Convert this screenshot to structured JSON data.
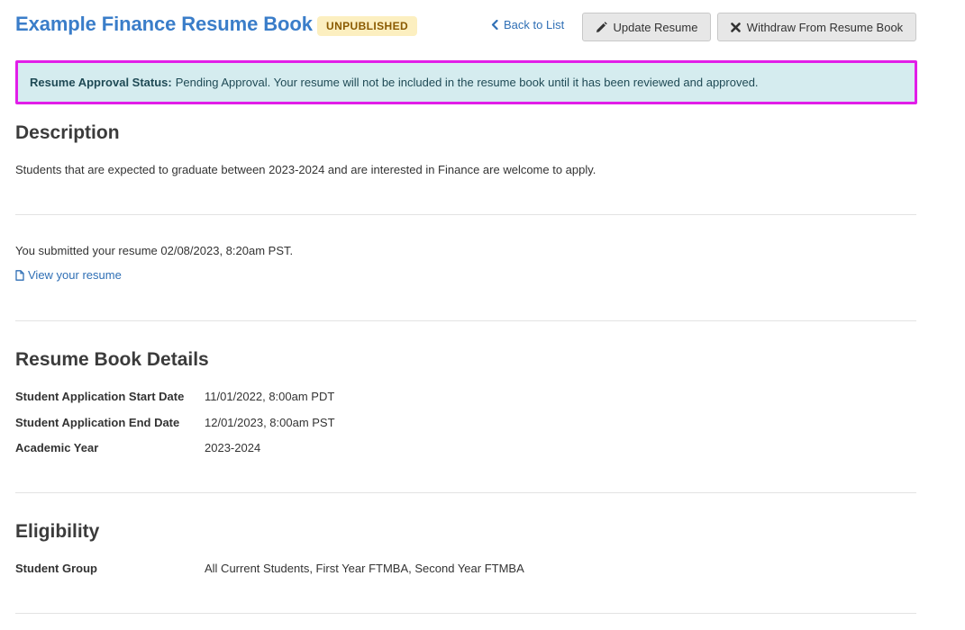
{
  "header": {
    "title": "Example Finance Resume Book",
    "status_badge": "UNPUBLISHED",
    "back_link": "Back to List",
    "update_button": "Update Resume",
    "withdraw_button": "Withdraw From Resume Book"
  },
  "approval": {
    "label": "Resume Approval Status:",
    "message": "Pending Approval. Your resume will not be included in the resume book until it has been reviewed and approved."
  },
  "description": {
    "heading": "Description",
    "text": "Students that are expected to graduate between 2023-2024 and are interested in Finance are welcome to apply."
  },
  "submission": {
    "text": "You submitted your resume 02/08/2023, 8:20am PST.",
    "view_link": "View your resume"
  },
  "details": {
    "heading": "Resume Book Details",
    "rows": [
      {
        "label": "Student Application Start Date",
        "value": "11/01/2022, 8:00am PDT"
      },
      {
        "label": "Student Application End Date",
        "value": "12/01/2023, 8:00am PST"
      },
      {
        "label": "Academic Year",
        "value": "2023-2024"
      }
    ]
  },
  "eligibility": {
    "heading": "Eligibility",
    "rows": [
      {
        "label": "Student Group",
        "value": "All Current Students, First Year FTMBA, Second Year FTMBA"
      }
    ]
  },
  "colors": {
    "title": "#3a7dc9",
    "badge_bg": "#fcefc0",
    "badge_text": "#8a5a00",
    "banner_bg": "#d5ecef",
    "banner_border": "#e11ee8",
    "link": "#2f6fb5"
  },
  "icons": {
    "back": "chevron-left-icon",
    "update": "pencil-icon",
    "withdraw": "x-icon",
    "resume": "file-icon"
  }
}
